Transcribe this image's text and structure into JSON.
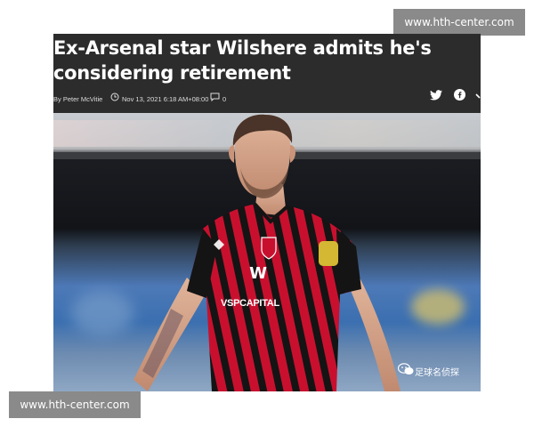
{
  "watermarks": {
    "top": "www.hth-center.com",
    "bottom": "www.hth-center.com"
  },
  "article": {
    "headline_line1": "Ex-Arsenal star Wilshere admits he's",
    "headline_line2": "considering retirement",
    "author": "By Peter McVitie",
    "date": "Nov 13, 2021 6:18 AM+08:00",
    "comment_count": "0",
    "icons": {
      "clock": "clock-icon",
      "comment": "comment-icon",
      "twitter": "twitter-icon",
      "facebook": "facebook-icon",
      "more": "more-icon"
    }
  },
  "photo": {
    "caption": "足球名侦探",
    "sponsor_text": "VSPCAPITAL",
    "sponsor_logo": "W",
    "caption_icon": "wechat-icon"
  },
  "colors": {
    "header_bg": "#2c2c2c",
    "jersey_red": "#c8102e",
    "jersey_black": "#141414",
    "watermark_bg": "#8a8a8a"
  }
}
